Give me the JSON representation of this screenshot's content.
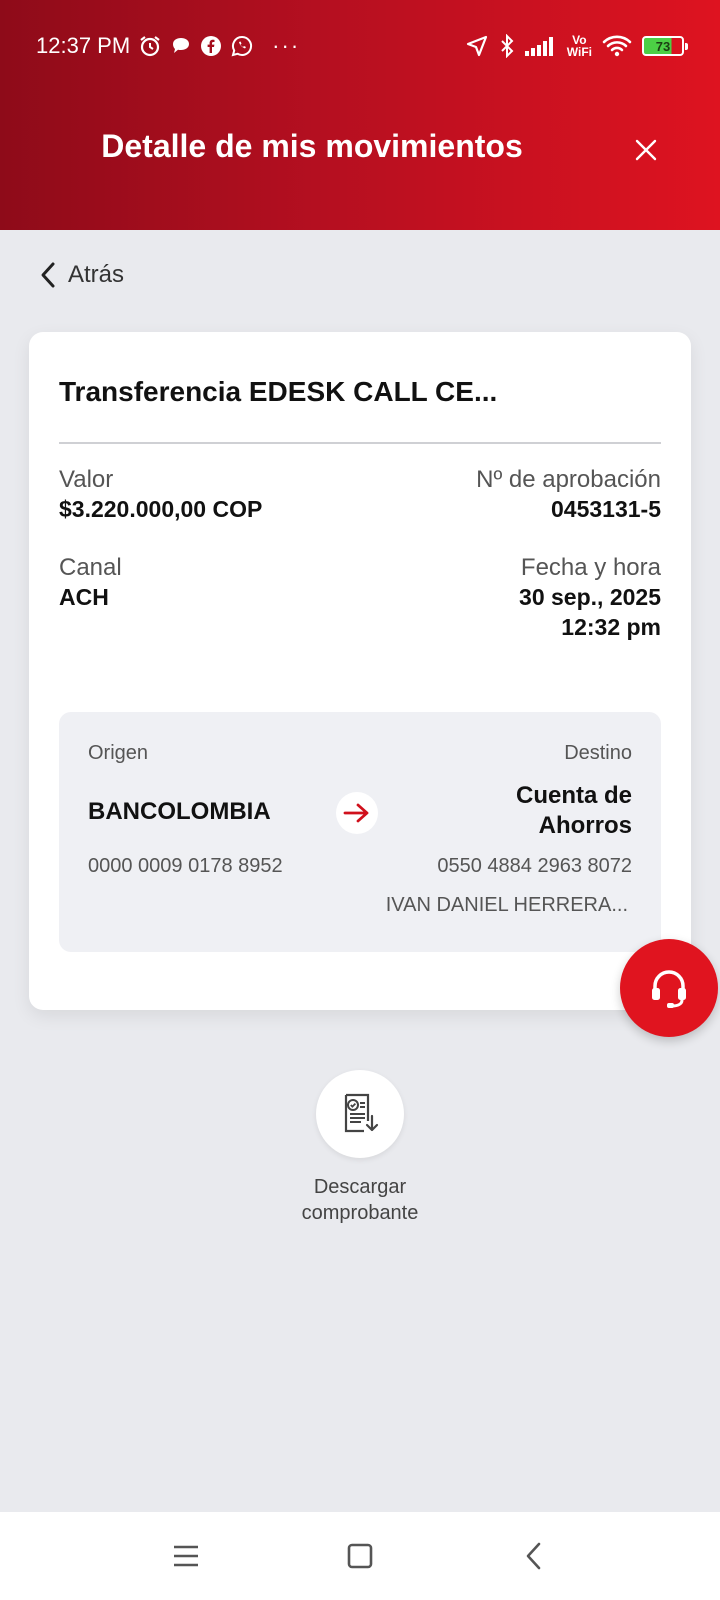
{
  "status_bar": {
    "time": "12:37 PM",
    "more": "···",
    "vowifi_top": "Vo",
    "vowifi_bottom": "WiFi",
    "battery": "73",
    "icons_left": [
      "alarm-icon",
      "chat-bubble-icon",
      "facebook-icon",
      "whatsapp-icon"
    ],
    "icons_right": [
      "location-arrow-icon",
      "bluetooth-icon",
      "signal-icon",
      "vowifi-icon",
      "wifi-icon",
      "battery-icon"
    ]
  },
  "header": {
    "title": "Detalle de mis movimientos",
    "close_icon": "close-icon",
    "gradient": [
      "#8e0b19",
      "#de1320"
    ]
  },
  "back": {
    "label": "Atrás"
  },
  "card": {
    "title": "Transferencia EDESK CALL CE...",
    "valor_label": "Valor",
    "valor": "$3.220.000,00 COP",
    "aprobacion_label": "Nº de aprobación",
    "aprobacion": "0453131-5",
    "canal_label": "Canal",
    "canal": "ACH",
    "fecha_label": "Fecha y hora",
    "fecha": "30 sep., 2025",
    "hora": "12:32 pm"
  },
  "transfer": {
    "origen_label": "Origen",
    "destino_label": "Destino",
    "origen_bank": "BANCOLOMBIA",
    "destino_line1": "Cuenta de",
    "destino_line2": "Ahorros",
    "origen_account": "0000 0009 0178 8952",
    "destino_account": "0550 4884 2963 8072",
    "destino_holder": "IVAN DANIEL HERRERA..."
  },
  "download": {
    "line1": "Descargar",
    "line2": "comprobante"
  },
  "colors": {
    "accent": "#e0141f",
    "background": "#e9eaee"
  }
}
